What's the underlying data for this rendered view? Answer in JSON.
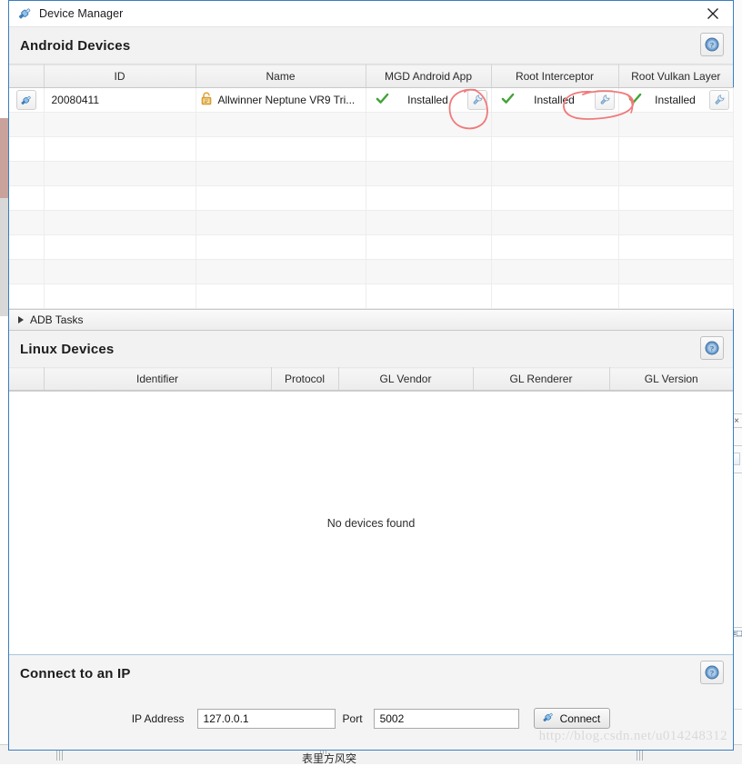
{
  "window": {
    "title": "Device Manager",
    "title_icon": "plug-icon",
    "close_icon": "close-icon"
  },
  "android_section": {
    "title": "Android Devices",
    "help_icon": "help-icon",
    "columns": [
      "",
      "ID",
      "Name",
      "MGD Android App",
      "Root Interceptor",
      "Root Vulkan Layer"
    ],
    "rows": [
      {
        "device_icon": "plug-icon",
        "id": "20080411",
        "name": "Allwinner Neptune VR9 Tri...",
        "name_icon": "lock-icon",
        "mgd_android_app": {
          "status_icon": "green-check-icon",
          "label": "Installed",
          "tool_icon": "wrench-icon"
        },
        "root_interceptor": {
          "status_icon": "green-check-icon",
          "label": "Installed",
          "tool_icon": "wrench-icon"
        },
        "root_vulkan_layer": {
          "status_icon": "green-check-icon",
          "label": "Installed",
          "tool_icon": "wrench-icon"
        }
      }
    ],
    "empty_row_count": 8
  },
  "adb_tasks": {
    "label": "ADB Tasks",
    "expander_icon": "triangle-right-icon",
    "expanded": false
  },
  "linux_section": {
    "title": "Linux Devices",
    "help_icon": "help-icon",
    "columns": [
      "",
      "Identifier",
      "Protocol",
      "GL Vendor",
      "GL Renderer",
      "GL Version"
    ],
    "empty_message": "No devices found"
  },
  "connect_section": {
    "title": "Connect to an IP",
    "help_icon": "help-icon",
    "ip_label": "IP Address",
    "ip_value": "127.0.0.1",
    "ip_placeholder": "127.0.0.1",
    "port_label": "Port",
    "port_value": "5002",
    "port_placeholder": "5002",
    "connect_label": "Connect",
    "connect_icon": "plug-icon"
  },
  "watermark": {
    "text": "http://blog.csdn.net/u014248312"
  },
  "background": {
    "cjk_text": "表里方风突"
  },
  "colors": {
    "accent_border": "#3a7ebf",
    "annotation_red": "#f07a7a",
    "check_green": "#41a336",
    "lock_orange": "#e8a33d",
    "header_bg": "#f2f2f2",
    "row_alt_bg": "#f7f7f7"
  }
}
